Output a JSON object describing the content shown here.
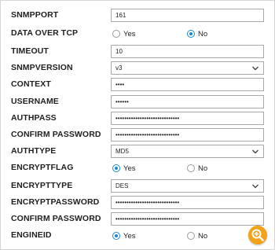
{
  "form": {
    "snmpport": {
      "label": "SNMPPORT",
      "value": "161"
    },
    "data_over_tcp": {
      "label": "DATA OVER TCP",
      "options": [
        "Yes",
        "No"
      ],
      "selected": "No"
    },
    "timeout": {
      "label": "TIMEOUT",
      "value": "10"
    },
    "snmpversion": {
      "label": "SNMPVERSION",
      "value": "v3"
    },
    "context": {
      "label": "CONTEXT",
      "value": "••••"
    },
    "username": {
      "label": "USERNAME",
      "value": "••••••"
    },
    "authpass": {
      "label": "AUTHPASS",
      "value": "•••••••••••••••••••••••••••••"
    },
    "confirm_password_1": {
      "label": "CONFIRM PASSWORD",
      "value": "•••••••••••••••••••••••••••••"
    },
    "authtype": {
      "label": "AUTHTYPE",
      "value": "MD5"
    },
    "encryptflag": {
      "label": "ENCRYPTFLAG",
      "options": [
        "Yes",
        "No"
      ],
      "selected": "Yes"
    },
    "encrypttype": {
      "label": "ENCRYPTTYPE",
      "value": "DES"
    },
    "encryptpassword": {
      "label": "ENCRYPTPASSWORD",
      "value": "•••••••••••••••••••••••••••••"
    },
    "confirm_password_2": {
      "label": "CONFIRM PASSWORD",
      "value": "•••••••••••••••••••••••••••••"
    },
    "engineid": {
      "label": "ENGINEID",
      "options": [
        "Yes",
        "No"
      ],
      "selected": "Yes"
    }
  },
  "icons": {
    "chevron": "chevron-down-icon",
    "zoom": "zoom-in-icon"
  },
  "colors": {
    "accent": "#1a88d8",
    "zoom_button": "#f3a319"
  }
}
